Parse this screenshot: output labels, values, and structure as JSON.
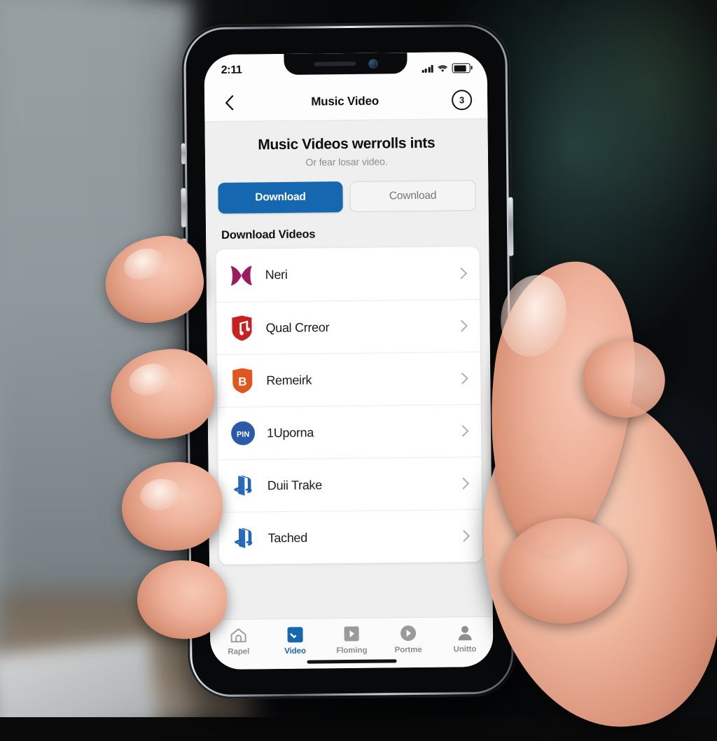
{
  "status_bar": {
    "time": "2:11",
    "signal_icon": "cellular-bars-icon",
    "wifi_icon": "wifi-icon",
    "battery_icon": "battery-full-icon"
  },
  "nav_bar": {
    "back_icon": "chevron-left-icon",
    "title": "Music Video",
    "badge": "3",
    "badge_icon": "circle-badge-icon"
  },
  "hero": {
    "title": "Music Videos werrolls ints",
    "subtitle": "Or fear losar video."
  },
  "segmented": {
    "primary_label": "Download",
    "secondary_label": "Cownload"
  },
  "section": {
    "heading": "Download Videos"
  },
  "list": {
    "items": [
      {
        "label": "Neri",
        "icon": "butterfly-bowtie-icon",
        "color": "#9B1B62",
        "chevron": "chevron-right-icon"
      },
      {
        "label": "Qual Crreor",
        "icon": "red-shield-music-note-icon",
        "color": "#C62222",
        "chevron": "chevron-right-icon"
      },
      {
        "label": "Remeirk",
        "icon": "orange-shield-b-icon",
        "color": "#E0561F",
        "chevron": "chevron-right-icon"
      },
      {
        "label": "1Uporna",
        "icon": "pin-circle-icon",
        "color": "#2B5BA8",
        "chevron": "chevron-right-icon"
      },
      {
        "label": "Duii Trake",
        "icon": "playstation-logo-icon",
        "color": "#1F63B8",
        "chevron": "chevron-right-icon"
      },
      {
        "label": "Tached",
        "icon": "playstation-logo-icon",
        "color": "#1F63B8",
        "chevron": "chevron-right-icon"
      }
    ]
  },
  "tab_bar": {
    "items": [
      {
        "label": "Rapel",
        "icon": "home-outline-icon",
        "active": false
      },
      {
        "label": "Video",
        "icon": "video-check-icon",
        "active": true
      },
      {
        "label": "Floming",
        "icon": "play-square-icon",
        "active": false
      },
      {
        "label": "Portme",
        "icon": "play-circle-icon",
        "active": false
      },
      {
        "label": "Unitto",
        "icon": "person-icon",
        "active": false
      }
    ]
  },
  "theme": {
    "accent": "#1568b0",
    "page_bg": "#efefef",
    "card_bg": "#ffffff",
    "muted_text": "#8c8c8c"
  }
}
